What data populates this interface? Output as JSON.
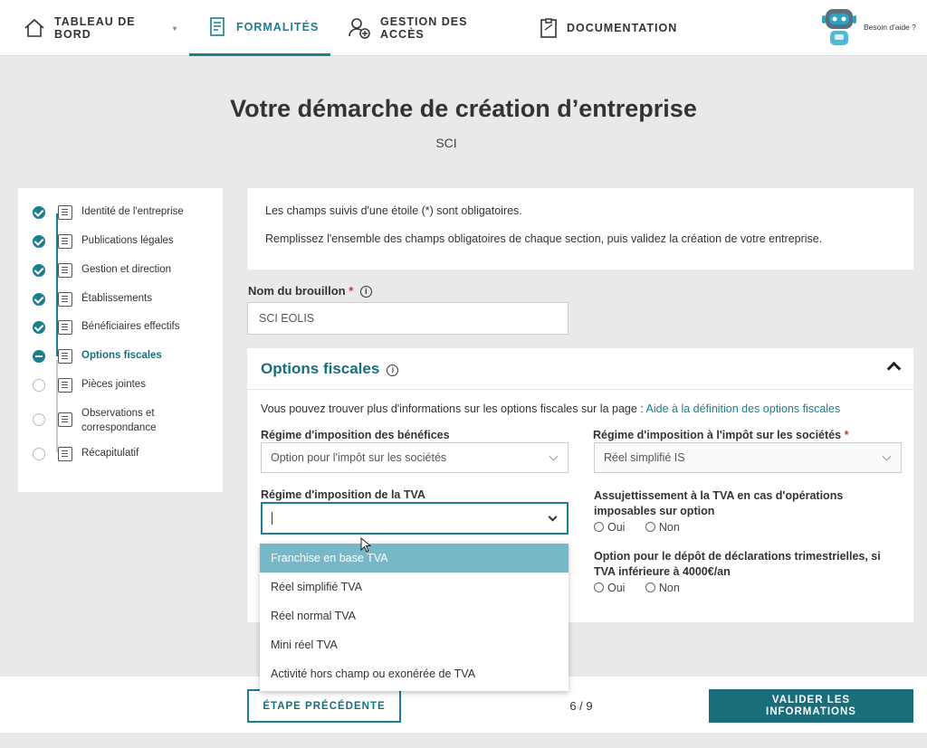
{
  "nav": {
    "items": [
      {
        "label": "TABLEAU DE BORD",
        "icon": "home-icon"
      },
      {
        "label": "FORMALITÉS",
        "icon": "document-list-icon"
      },
      {
        "label": "GESTION DES ACCÈS",
        "icon": "user-add-icon"
      },
      {
        "label": "DOCUMENTATION",
        "icon": "clipboard-icon"
      }
    ],
    "help_label": "Besoin d'aide ?",
    "accent": "#1a7f8e"
  },
  "page": {
    "title": "Votre démarche de création d’entreprise",
    "subtitle": "SCI"
  },
  "steps": [
    {
      "label": "Identité de l'entreprise",
      "status": "done"
    },
    {
      "label": "Publications légales",
      "status": "done"
    },
    {
      "label": "Gestion et direction",
      "status": "done"
    },
    {
      "label": "Établissements",
      "status": "done"
    },
    {
      "label": "Bénéficiaires effectifs",
      "status": "done"
    },
    {
      "label": "Options fiscales",
      "status": "current"
    },
    {
      "label": "Pièces jointes",
      "status": "todo"
    },
    {
      "label": "Observations et correspondance",
      "status": "todo"
    },
    {
      "label": "Récapitulatif",
      "status": "todo"
    }
  ],
  "info": {
    "line1": "Les champs suivis d'une étoile (*) sont obligatoires.",
    "line2": "Remplissez l'ensemble des champs obligatoires de chaque section, puis validez la création de votre entreprise."
  },
  "draft": {
    "label": "Nom du brouillon",
    "required": "*",
    "value": "SCI EOLIS"
  },
  "fiscal": {
    "title": "Options fiscales",
    "intro": "Vous pouvez trouver plus d'informations sur les options fiscales sur la page :",
    "intro_link": "Aide à la définition des options fiscales",
    "benefits_label": "Régime d'imposition des bénéfices",
    "benefits_value": "Option pour l'impôt sur les sociétés",
    "is_label": "Régime d'imposition à l'impôt sur les sociétés",
    "is_required": "*",
    "is_value": "Réel simplifié IS",
    "tva_label": "Régime d'imposition de la TVA",
    "tva_value": "",
    "assuj_label": "Assujettissement à la TVA en cas d'opérations imposables sur option",
    "option_label": "Option pour le dépôt de déclarations trimestrielles, si TVA inférieure à 4000€/an",
    "yes": "Oui",
    "no": "Non"
  },
  "tva_options": [
    "Franchise en base TVA",
    "Réel simplifié TVA",
    "Réel normal TVA",
    "Mini réel TVA",
    "Activité hors champ ou exonérée de TVA"
  ],
  "footer": {
    "prev": "ÉTAPE PRÉCÉDENTE",
    "pager": "6 / 9",
    "next": "VALIDER LES INFORMATIONS"
  }
}
